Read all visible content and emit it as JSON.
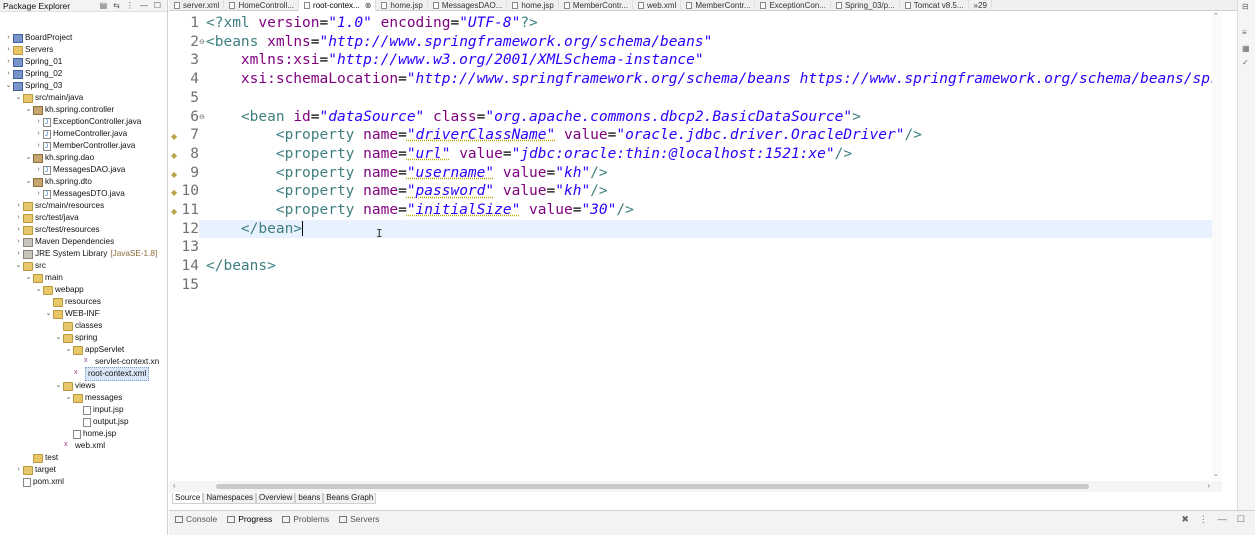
{
  "explorer": {
    "title": "Package Explorer",
    "tree": [
      {
        "label": "BoardProject",
        "depth": 0,
        "tw": ">",
        "icon": "proj"
      },
      {
        "label": "Servers",
        "depth": 0,
        "tw": ">",
        "icon": "folder"
      },
      {
        "label": "Spring_01",
        "depth": 0,
        "tw": ">",
        "icon": "proj"
      },
      {
        "label": "Spring_02",
        "depth": 0,
        "tw": ">",
        "icon": "proj"
      },
      {
        "label": "Spring_03",
        "depth": 0,
        "tw": "v",
        "icon": "proj"
      },
      {
        "label": "src/main/java",
        "depth": 1,
        "tw": "v",
        "icon": "srcf"
      },
      {
        "label": "kh.spring.controller",
        "depth": 2,
        "tw": "v",
        "icon": "pkg"
      },
      {
        "label": "ExceptionController.java",
        "depth": 3,
        "tw": ">",
        "icon": "jfile"
      },
      {
        "label": "HomeController.java",
        "depth": 3,
        "tw": ">",
        "icon": "jfile"
      },
      {
        "label": "MemberController.java",
        "depth": 3,
        "tw": ">",
        "icon": "jfile"
      },
      {
        "label": "kh.spring.dao",
        "depth": 2,
        "tw": "v",
        "icon": "pkg"
      },
      {
        "label": "MessagesDAO.java",
        "depth": 3,
        "tw": ">",
        "icon": "jfile"
      },
      {
        "label": "kh.spring.dto",
        "depth": 2,
        "tw": "v",
        "icon": "pkg"
      },
      {
        "label": "MessagesDTO.java",
        "depth": 3,
        "tw": ">",
        "icon": "jfile"
      },
      {
        "label": "src/main/resources",
        "depth": 1,
        "tw": ">",
        "icon": "srcf"
      },
      {
        "label": "src/test/java",
        "depth": 1,
        "tw": ">",
        "icon": "srcf"
      },
      {
        "label": "src/test/resources",
        "depth": 1,
        "tw": ">",
        "icon": "srcf"
      },
      {
        "label": "Maven Dependencies",
        "depth": 1,
        "tw": ">",
        "icon": "lib"
      },
      {
        "label": "JRE System Library",
        "extra": "[JavaSE-1.8]",
        "depth": 1,
        "tw": ">",
        "icon": "lib"
      },
      {
        "label": "src",
        "depth": 1,
        "tw": "v",
        "icon": "folder"
      },
      {
        "label": "main",
        "depth": 2,
        "tw": "v",
        "icon": "folder"
      },
      {
        "label": "webapp",
        "depth": 3,
        "tw": "v",
        "icon": "folder"
      },
      {
        "label": "resources",
        "depth": 4,
        "tw": "",
        "icon": "folder"
      },
      {
        "label": "WEB-INF",
        "depth": 4,
        "tw": "v",
        "icon": "folder"
      },
      {
        "label": "classes",
        "depth": 5,
        "tw": "",
        "icon": "folder"
      },
      {
        "label": "spring",
        "depth": 5,
        "tw": "v",
        "icon": "folder"
      },
      {
        "label": "appServlet",
        "depth": 6,
        "tw": "v",
        "icon": "folder"
      },
      {
        "label": "servlet-context.xn",
        "depth": 7,
        "tw": "",
        "icon": "xfile"
      },
      {
        "label": "root-context.xml",
        "depth": 6,
        "tw": "",
        "icon": "xfile",
        "selected": true
      },
      {
        "label": "views",
        "depth": 5,
        "tw": "v",
        "icon": "folder"
      },
      {
        "label": "messages",
        "depth": 6,
        "tw": "v",
        "icon": "folder"
      },
      {
        "label": "input.jsp",
        "depth": 7,
        "tw": "",
        "icon": "file"
      },
      {
        "label": "output.jsp",
        "depth": 7,
        "tw": "",
        "icon": "file"
      },
      {
        "label": "home.jsp",
        "depth": 6,
        "tw": "",
        "icon": "file"
      },
      {
        "label": "web.xml",
        "depth": 5,
        "tw": "",
        "icon": "xfile"
      },
      {
        "label": "test",
        "depth": 2,
        "tw": "",
        "icon": "folder"
      },
      {
        "label": "target",
        "depth": 1,
        "tw": ">",
        "icon": "folder"
      },
      {
        "label": "pom.xml",
        "depth": 1,
        "tw": "",
        "icon": "file"
      }
    ]
  },
  "tabs": [
    {
      "label": "server.xml",
      "active": false
    },
    {
      "label": "HomeControll...",
      "active": false
    },
    {
      "label": "root-contex...",
      "active": true
    },
    {
      "label": "home.jsp",
      "active": false
    },
    {
      "label": "MessagesDAO...",
      "active": false
    },
    {
      "label": "home.jsp",
      "active": false
    },
    {
      "label": "MemberContr...",
      "active": false
    },
    {
      "label": "web.xml",
      "active": false
    },
    {
      "label": "MemberContr...",
      "active": false
    },
    {
      "label": "ExceptionCon...",
      "active": false
    },
    {
      "label": "Spring_03/p...",
      "active": false
    },
    {
      "label": "Tomcat v8.5...",
      "active": false
    },
    {
      "label": "»29",
      "active": false
    }
  ],
  "editor": {
    "lines": [
      {
        "n": "1",
        "html": "<span class='t-pi'>&lt;?xml</span> <span class='t-attr'>version</span>=<span class='t-str'>\"1.0\"</span> <span class='t-attr'>encoding</span>=<span class='t-str'>\"UTF-8\"</span><span class='t-pi'>?&gt;</span>"
      },
      {
        "n": "2",
        "fold": "⊖",
        "html": "<span class='t-tag'>&lt;beans</span> <span class='t-attr'>xmlns</span>=<span class='t-str'>\"http://www.springframework.org/schema/beans\"</span>"
      },
      {
        "n": "3",
        "html": "    <span class='t-attr'>xmlns:xsi</span>=<span class='t-str'>\"http://www.w3.org/2001/XMLSchema-instance\"</span>"
      },
      {
        "n": "4",
        "html": "    <span class='t-attr'>xsi:schemaLocation</span>=<span class='t-str'>\"http://www.springframework.org/schema/beans https://www.springframework.org/schema/beans/spr</span>"
      },
      {
        "n": "5",
        "html": ""
      },
      {
        "n": "6",
        "fold": "⊖",
        "html": "    <span class='t-tag'>&lt;bean</span> <span class='t-attr'>id</span>=<span class='t-str'>\"dataSource\"</span> <span class='t-attr'>class</span>=<span class='t-str'>\"org.apache.commons.dbcp2.BasicDataSource\"</span><span class='t-tag'>&gt;</span>"
      },
      {
        "n": "7",
        "ann": true,
        "html": "        <span class='t-tag'>&lt;property</span> <span class='t-attr'>name</span>=<span class='t-str t-err'>\"driverClassName\"</span> <span class='t-attr'>value</span>=<span class='t-str'>\"oracle.jdbc.driver.OracleDriver\"</span><span class='t-tag'>/&gt;</span>"
      },
      {
        "n": "8",
        "ann": true,
        "html": "        <span class='t-tag'>&lt;property</span> <span class='t-attr'>name</span>=<span class='t-str t-err'>\"url\"</span> <span class='t-attr'>value</span>=<span class='t-str'>\"jdbc:oracle:thin:@localhost:1521:xe\"</span><span class='t-tag'>/&gt;</span>"
      },
      {
        "n": "9",
        "ann": true,
        "html": "        <span class='t-tag'>&lt;property</span> <span class='t-attr'>name</span>=<span class='t-str t-err'>\"username\"</span> <span class='t-attr'>value</span>=<span class='t-str'>\"kh\"</span><span class='t-tag'>/&gt;</span>"
      },
      {
        "n": "10",
        "ann": true,
        "html": "        <span class='t-tag'>&lt;property</span> <span class='t-attr'>name</span>=<span class='t-str t-err'>\"password\"</span> <span class='t-attr'>value</span>=<span class='t-str'>\"kh\"</span><span class='t-tag'>/&gt;</span>"
      },
      {
        "n": "11",
        "ann": true,
        "html": "        <span class='t-tag'>&lt;property</span> <span class='t-attr'>name</span>=<span class='t-str t-err'>\"initialSize\"</span> <span class='t-attr'>value</span>=<span class='t-str'>\"30\"</span><span class='t-tag'>/&gt;</span>"
      },
      {
        "n": "12",
        "current": true,
        "html": "    <span class='t-tag'>&lt;/bean&gt;</span><span class='cursor'></span>"
      },
      {
        "n": "13",
        "html": ""
      },
      {
        "n": "14",
        "html": "<span class='t-tag'>&lt;/beans&gt;</span>"
      },
      {
        "n": "15",
        "html": ""
      }
    ]
  },
  "subtabs": [
    {
      "label": "Source",
      "active": true
    },
    {
      "label": "Namespaces",
      "active": false
    },
    {
      "label": "Overview",
      "active": false
    },
    {
      "label": "beans",
      "active": false
    },
    {
      "label": "Beans Graph",
      "active": false
    }
  ],
  "panel": {
    "tabs": [
      {
        "label": "Console",
        "active": false
      },
      {
        "label": "Progress",
        "active": true
      },
      {
        "label": "Problems",
        "active": false
      },
      {
        "label": "Servers",
        "active": false
      }
    ]
  },
  "colors": {
    "tag": "#3f7f7f",
    "attr": "#7f007f",
    "string": "#2a00ff",
    "current_line": "#e8f2fe"
  }
}
